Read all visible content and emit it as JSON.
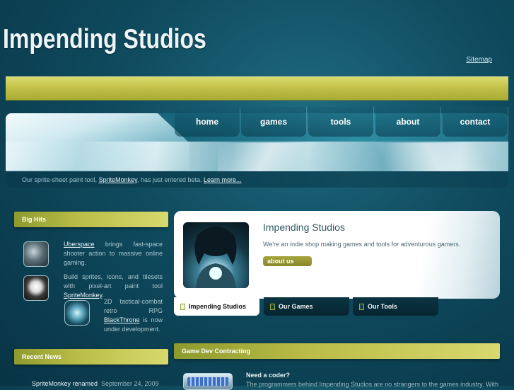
{
  "header": {
    "logo_text": "Impending Studios",
    "sitemap_label": "Sitemap"
  },
  "nav": {
    "items": [
      "home",
      "games",
      "tools",
      "about",
      "contact"
    ]
  },
  "teaser": {
    "prefix": "Our sprite-sheet paint tool,",
    "link": "SpriteMonkey",
    "middle": ", has just entered beta.",
    "more": "Learn more..."
  },
  "big_hits": {
    "heading": "Big Hits",
    "items": [
      {
        "link": "Uberspace",
        "before": "",
        "after": " brings fast-space shooter action to massive online gaming.",
        "icon": "uberspace-icon"
      },
      {
        "link": "SpriteMonkey",
        "before": "Build sprites, icons, and tilesets with pixel-art paint tool ",
        "after": ".",
        "icon": "monkey-icon"
      },
      {
        "link": "BlackThrone",
        "before": "2D tactical-combat retro RPG ",
        "after": " is now under development.",
        "icon": "blackthrone-icon"
      }
    ]
  },
  "recent_news": {
    "heading": "Recent News",
    "first_title": "SpriteMonkey renamed",
    "first_date": "September 24, 2009"
  },
  "feature": {
    "title": "Impending Studios",
    "text": "We're an indie shop making games and tools for adventurous gamers.",
    "button": "about us",
    "tabs": [
      "Impending Studios",
      "Our Games",
      "Our Tools"
    ]
  },
  "contracting": {
    "heading": "Game Dev Contracting",
    "subheading": "Need a coder?",
    "text": "The programmers behind Impending Studios are no strangers to the games industry. With"
  },
  "colors": {
    "background": "#0f4a5e",
    "accent_yellow": "#c3c24a",
    "link": "#e8f4f7"
  }
}
